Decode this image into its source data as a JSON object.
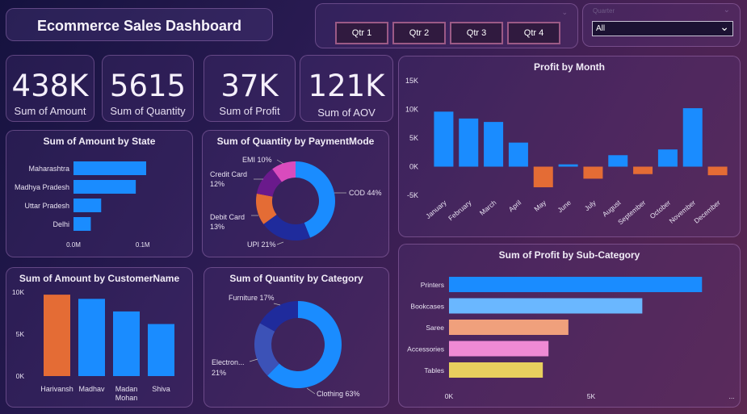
{
  "header": {
    "title": "Ecommerce Sales Dashboard"
  },
  "slicer": {
    "buttons": [
      "Qtr 1",
      "Qtr 2",
      "Qtr 3",
      "Qtr 4"
    ],
    "dropdown_label": "Quarter",
    "dropdown_value": "All"
  },
  "kpis": [
    {
      "value": "438K",
      "label": "Sum of Amount"
    },
    {
      "value": "5615",
      "label": "Sum of Quantity"
    },
    {
      "value": "37K",
      "label": "Sum of Profit"
    },
    {
      "value": "121K",
      "label": "Sum of AOV"
    }
  ],
  "colors": {
    "blue": "#1a8cff",
    "orange": "#e46c35",
    "navy": "#1f2b9c",
    "purple": "#6a1a8c",
    "pink": "#d94bbd",
    "light_blue": "#6ab7ff",
    "salmon": "#f0a07c",
    "light_pink": "#ef8ad4",
    "yellow": "#e8cf5e",
    "slate": "#3c52b7"
  },
  "chart_data": [
    {
      "type": "bar",
      "title": "Sum of Amount by State",
      "orientation": "horizontal",
      "categories": [
        "Maharashtra",
        "Madhya Pradesh",
        "Uttar Pradesh",
        "Delhi"
      ],
      "values": [
        0.105,
        0.09,
        0.04,
        0.025
      ],
      "xticks": [
        "0.0M",
        "0.1M"
      ],
      "xlim": [
        0,
        0.105
      ]
    },
    {
      "type": "pie",
      "title": "Sum of Quantity by PaymentMode",
      "donut": true,
      "slices": [
        {
          "label": "COD",
          "value": 44,
          "display": "COD 44%"
        },
        {
          "label": "UPI",
          "value": 21,
          "display": "UPI 21%"
        },
        {
          "label": "Debit Card",
          "value": 13,
          "display": "Debit Card|13%"
        },
        {
          "label": "Credit Card",
          "value": 12,
          "display": "Credit Card|12%"
        },
        {
          "label": "EMI",
          "value": 10,
          "display": "EMI 10%"
        }
      ]
    },
    {
      "type": "bar",
      "title": "Profit by Month",
      "categories": [
        "January",
        "February",
        "March",
        "April",
        "May",
        "June",
        "July",
        "August",
        "September",
        "October",
        "November",
        "December"
      ],
      "values": [
        9600,
        8400,
        7800,
        4200,
        -3600,
        400,
        -2100,
        2000,
        -1300,
        3000,
        10200,
        -1500
      ],
      "yticks": [
        "15K",
        "10K",
        "5K",
        "0K",
        "-5K"
      ],
      "ylim": [
        -5000,
        15000
      ]
    },
    {
      "type": "bar",
      "title": "Sum of Amount by CustomerName",
      "categories": [
        "Harivansh",
        "Madhav",
        "Madan|Mohan",
        "Shiva"
      ],
      "values": [
        9700,
        9200,
        7700,
        6200
      ],
      "highlight_index": 0,
      "yticks": [
        "10K",
        "5K",
        "0K"
      ],
      "ylim": [
        0,
        10000
      ]
    },
    {
      "type": "pie",
      "title": "Sum of Quantity by Category",
      "donut": true,
      "slices": [
        {
          "label": "Clothing",
          "value": 63,
          "display": "Clothing 63%"
        },
        {
          "label": "Electronics",
          "value": 21,
          "display": "Electron...|21%"
        },
        {
          "label": "Furniture",
          "value": 17,
          "display": "Furniture 17%"
        }
      ]
    },
    {
      "type": "bar",
      "title": "Sum of Profit by Sub-Category",
      "orientation": "horizontal",
      "categories": [
        "Printers",
        "Bookcases",
        "Saree",
        "Accessories",
        "Tables"
      ],
      "values": [
        8900,
        6800,
        4200,
        3500,
        3300
      ],
      "xticks": [
        "0K",
        "5K",
        "..."
      ],
      "xlim": [
        0,
        10000
      ]
    }
  ]
}
